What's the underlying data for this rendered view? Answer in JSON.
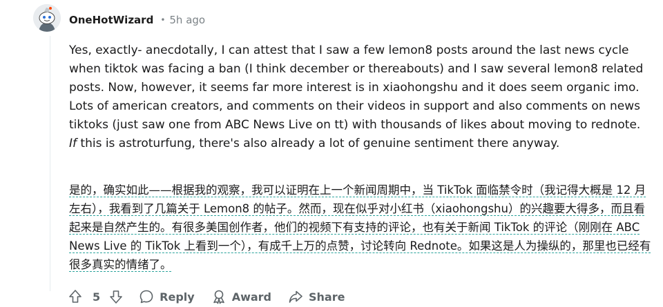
{
  "comment": {
    "username": "OneHotWizard",
    "separator": "•",
    "timestamp": "5h ago",
    "body_en_1": "Yes, exactly- anecdotally, I can attest that I saw a few lemon8 posts around the last news cycle when tiktok was facing a ban (I think december or thereabouts) and I saw several lemon8 related posts. Now, however, it seems far more interest is in xiaohongshu and it does seem organic imo. Lots of american creators, and comments on their videos in support and also comments on news tiktoks (just saw one from ABC News Live on tt) with thousands of likes about moving to rednote. ",
    "body_en_italic": "If",
    "body_en_2": " this is astroturfung, there's also already a lot of genuine sentiment there anyway.",
    "body_zh": "是的，确实如此——根据我的观察，我可以证明在上一个新闻周期中，当 TikTok 面临禁令时（我记得大概是 12 月左右），我看到了几篇关于 Lemon8 的帖子。然而，现在似乎对小红书（xiaohongshu）的兴趣要大得多，而且看起来是自然产生的。有很多美国创作者，他们的视频下有支持的评论，也有关于新闻 TikTok 的评论（刚刚在 ABC News Live 的 TikTok 上看到一个），有成千上万的点赞，讨论转向 Rednote。如果这是人为操纵的，那里也已经有很多真实的情绪了。"
  },
  "actions": {
    "vote_count": "5",
    "reply_label": "Reply",
    "award_label": "Award",
    "share_label": "Share"
  },
  "icons": {
    "upvote": "upvote-arrow-icon",
    "downvote": "downvote-arrow-icon",
    "reply": "speech-bubble-icon",
    "award": "award-ribbon-icon",
    "share": "share-arrow-icon"
  },
  "colors": {
    "meta_text": "#7c8387",
    "translation_underline": "#29a39c",
    "action_text": "#5d6468"
  }
}
